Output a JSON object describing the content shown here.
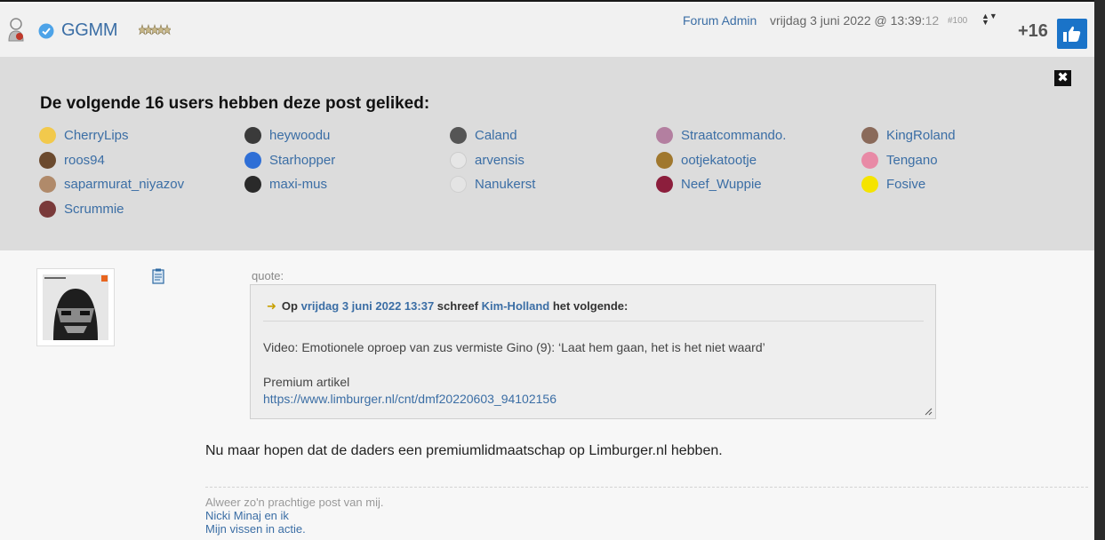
{
  "header": {
    "username": "GGMM",
    "role": "Forum Admin",
    "date_main": "vrijdag 3 juni 2022 @ 13:39:",
    "date_secs": "12",
    "post_number": "#100",
    "sort_icon": "up-down-arrows-icon",
    "like_count": "+16",
    "like_icon": "thumbs-up-icon"
  },
  "likes": {
    "title": "De volgende 16 users hebben deze post geliked:",
    "close_label": "✖",
    "users": [
      {
        "name": "CherryLips",
        "color": "#f2c94c"
      },
      {
        "name": "heywoodu",
        "color": "#3a3a3a"
      },
      {
        "name": "Caland",
        "color": "#555555"
      },
      {
        "name": "Straatcommando.",
        "color": "#b37fa0"
      },
      {
        "name": "KingRoland",
        "color": "#8a6a5a"
      },
      {
        "name": "roos94",
        "color": "#6b4a2e"
      },
      {
        "name": "Starhopper",
        "color": "#2f6fd6"
      },
      {
        "name": "arvensis",
        "color": "#e6e6e6"
      },
      {
        "name": "ootjekatootje",
        "color": "#a0782e"
      },
      {
        "name": "Tengano",
        "color": "#e88aa6"
      },
      {
        "name": "saparmurat_niyazov",
        "color": "#b08a6a"
      },
      {
        "name": "maxi-mus",
        "color": "#2a2a2a"
      },
      {
        "name": "Nanukerst",
        "color": "#e4e4e4"
      },
      {
        "name": "Neef_Wuppie",
        "color": "#8c1e3c"
      },
      {
        "name": "Fosive",
        "color": "#f5e400"
      },
      {
        "name": "Scrummie",
        "color": "#7a3a3a"
      }
    ]
  },
  "post": {
    "quote_label": "quote:",
    "quote": {
      "prefix": "Op",
      "date": "vrijdag 3 juni 2022 13:37",
      "middle": "schreef",
      "author": "Kim-Holland",
      "suffix": "het volgende:",
      "text": "Video: Emotionele oproep van zus vermiste Gino (9): ‘Laat hem gaan, het is het niet waard’",
      "premium": "Premium artikel",
      "url": "https://www.limburger.nl/cnt/dmf20220603_94102156"
    },
    "text": "Nu maar hopen dat de daders een premiumlidmaatschap op Limburger.nl hebben."
  },
  "signature": {
    "line1": "Alweer zo'n prachtige post van mij.",
    "link1": "Nicki Minaj en ik",
    "link2": "Mijn vissen in actie."
  }
}
